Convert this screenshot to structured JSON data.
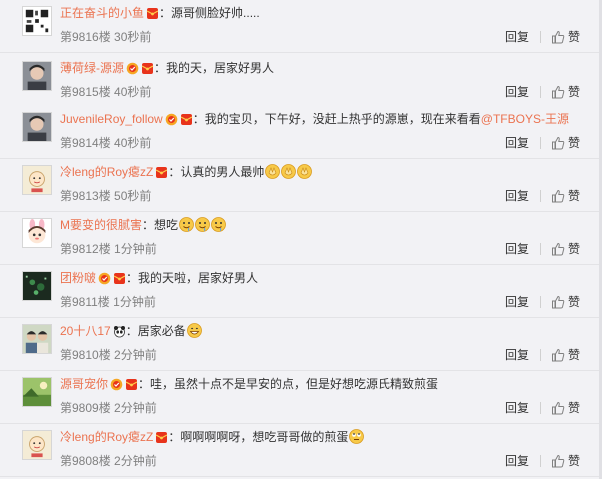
{
  "colors": {
    "username": "#eb7350",
    "text": "#333333",
    "meta": "#808080",
    "background": "#f2f2f5"
  },
  "comments": [
    {
      "user": "正在奋斗的小鱼",
      "badges": [
        "red-envelope"
      ],
      "colon": "：",
      "text": "源哥侧脸好帅.....",
      "emojis": [],
      "floor": "第9816楼",
      "time": "30秒前",
      "avatar_icon": "qr-avatar-icon",
      "reply_label": "回复",
      "like_label": "赞"
    },
    {
      "user": "薄荷绿-源源",
      "badges": [
        "vip-level",
        "red-envelope"
      ],
      "colon": "：",
      "text": "我的天，居家好男人",
      "emojis": [],
      "floor": "第9815楼",
      "time": "40秒前",
      "avatar_icon": "portrait-avatar-icon",
      "reply_label": "回复",
      "like_label": "赞"
    },
    {
      "user": "JuvenileRoy_follow",
      "badges": [
        "vip-level",
        "red-envelope"
      ],
      "colon": "：",
      "text": "我的宝贝，下午好，没赶上热乎的源崽，现在来看看",
      "mention": "@TFBOYS-王源",
      "emojis": [],
      "floor": "第9814楼",
      "time": "40秒前",
      "avatar_icon": "portrait-avatar-icon",
      "reply_label": "回复",
      "like_label": "赞"
    },
    {
      "user": "冷leng的Roy瘪zZ",
      "badges": [
        "red-envelope"
      ],
      "colon": "：",
      "text": "认真的男人最帅",
      "emojis": [
        "clapping-hands-emoji",
        "clapping-hands-emoji",
        "clapping-hands-emoji"
      ],
      "floor": "第9813楼",
      "time": "50秒前",
      "avatar_icon": "cartoon-avatar-icon",
      "reply_label": "回复",
      "like_label": "赞"
    },
    {
      "user": "M要变的很腻害",
      "badges": [],
      "colon": "：",
      "text": "想吃",
      "emojis": [
        "drooling-emoji",
        "drooling-emoji",
        "drooling-emoji"
      ],
      "floor": "第9812楼",
      "time": "1分钟前",
      "avatar_icon": "bunny-girl-avatar-icon",
      "reply_label": "回复",
      "like_label": "赞"
    },
    {
      "user": "团粉啵",
      "badges": [
        "vip-level",
        "red-envelope"
      ],
      "colon": "：",
      "text": "我的天啦，居家好男人",
      "emojis": [],
      "floor": "第9811楼",
      "time": "1分钟前",
      "avatar_icon": "dark-avatar-icon",
      "reply_label": "回复",
      "like_label": "赞"
    },
    {
      "user": "20十八17",
      "badges": [
        "panda"
      ],
      "colon": "：",
      "text": "居家必备",
      "emojis": [
        "grinning-emoji"
      ],
      "floor": "第9810楼",
      "time": "2分钟前",
      "avatar_icon": "group-photo-avatar-icon",
      "reply_label": "回复",
      "like_label": "赞"
    },
    {
      "user": "源哥宠你",
      "badges": [
        "vip-level",
        "red-envelope"
      ],
      "colon": "：",
      "text": "哇，虽然十点不是早安的点，但是好想吃源氏精致煎蛋",
      "emojis": [],
      "floor": "第9809楼",
      "time": "2分钟前",
      "avatar_icon": "landscape-avatar-icon",
      "reply_label": "回复",
      "like_label": "赞"
    },
    {
      "user": "冷leng的Roy瘪zZ",
      "badges": [
        "red-envelope"
      ],
      "colon": "：",
      "text": "啊啊啊啊呀，想吃哥哥做的煎蛋",
      "emojis": [
        "rolling-eyes-emoji"
      ],
      "floor": "第9808楼",
      "time": "2分钟前",
      "avatar_icon": "cartoon-avatar-icon",
      "reply_label": "回复",
      "like_label": "赞"
    }
  ]
}
